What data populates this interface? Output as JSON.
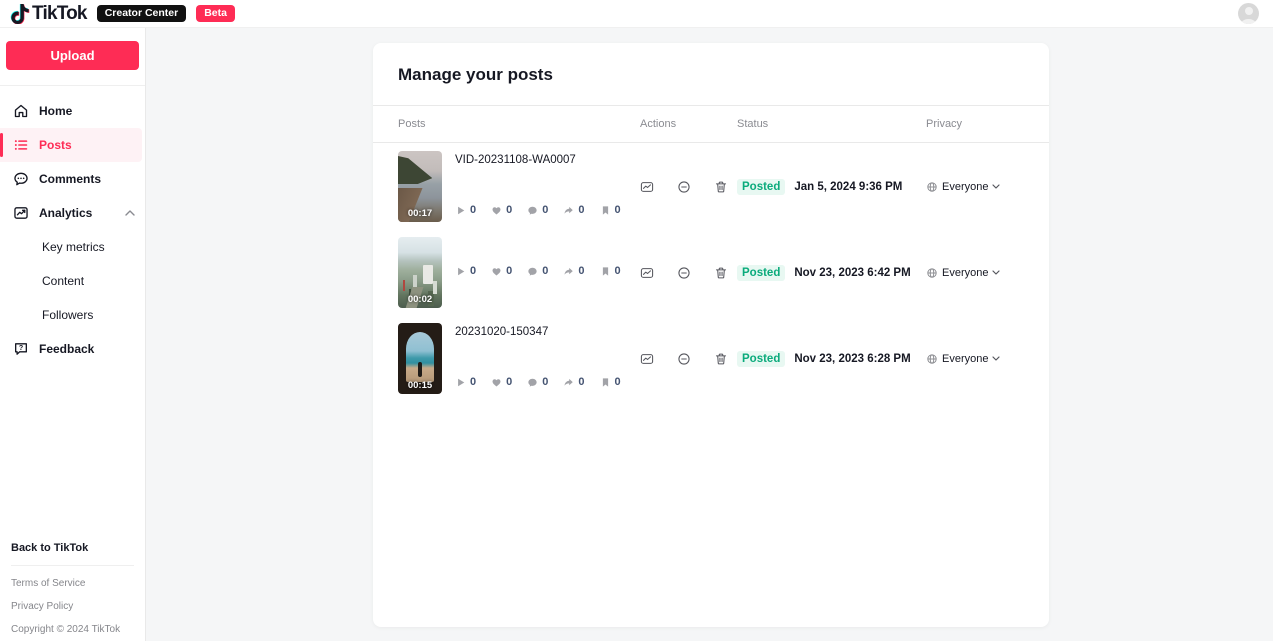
{
  "header": {
    "logo_text": "TikTok",
    "creator_center_badge": "Creator Center",
    "beta_badge": "Beta"
  },
  "sidebar": {
    "upload_label": "Upload",
    "items": [
      {
        "label": "Home",
        "active": false
      },
      {
        "label": "Posts",
        "active": true
      },
      {
        "label": "Comments",
        "active": false
      },
      {
        "label": "Analytics",
        "active": false,
        "expanded": true
      }
    ],
    "analytics_subitems": [
      "Key metrics",
      "Content",
      "Followers"
    ],
    "feedback_label": "Feedback",
    "back_label": "Back to TikTok",
    "footer_links": [
      "Terms of Service",
      "Privacy Policy"
    ],
    "copyright": "Copyright © 2024 TikTok"
  },
  "main": {
    "title": "Manage your posts",
    "columns": [
      "Posts",
      "Actions",
      "Status",
      "Privacy"
    ],
    "rows": [
      {
        "title": "VID-20231108-WA0007",
        "duration": "00:17",
        "thumb_kind": "beach",
        "stats": {
          "plays": "0",
          "likes": "0",
          "comments": "0",
          "shares": "0",
          "saves": "0"
        },
        "status": "Posted",
        "date": "Jan 5, 2024 9:36 PM",
        "privacy": "Everyone"
      },
      {
        "title": "",
        "duration": "00:02",
        "thumb_kind": "city",
        "stats": {
          "plays": "0",
          "likes": "0",
          "comments": "0",
          "shares": "0",
          "saves": "0"
        },
        "status": "Posted",
        "date": "Nov 23, 2023 6:42 PM",
        "privacy": "Everyone"
      },
      {
        "title": "20231020-150347",
        "duration": "00:15",
        "thumb_kind": "arch",
        "stats": {
          "plays": "0",
          "likes": "0",
          "comments": "0",
          "shares": "0",
          "saves": "0"
        },
        "status": "Posted",
        "date": "Nov 23, 2023 6:28 PM",
        "privacy": "Everyone"
      }
    ]
  },
  "colors": {
    "accent": "#FE2C55",
    "posted_text": "#0BAB7C",
    "posted_bg": "#E8F8F2",
    "main_bg": "#F5F6F7",
    "text_dark": "#161823"
  }
}
